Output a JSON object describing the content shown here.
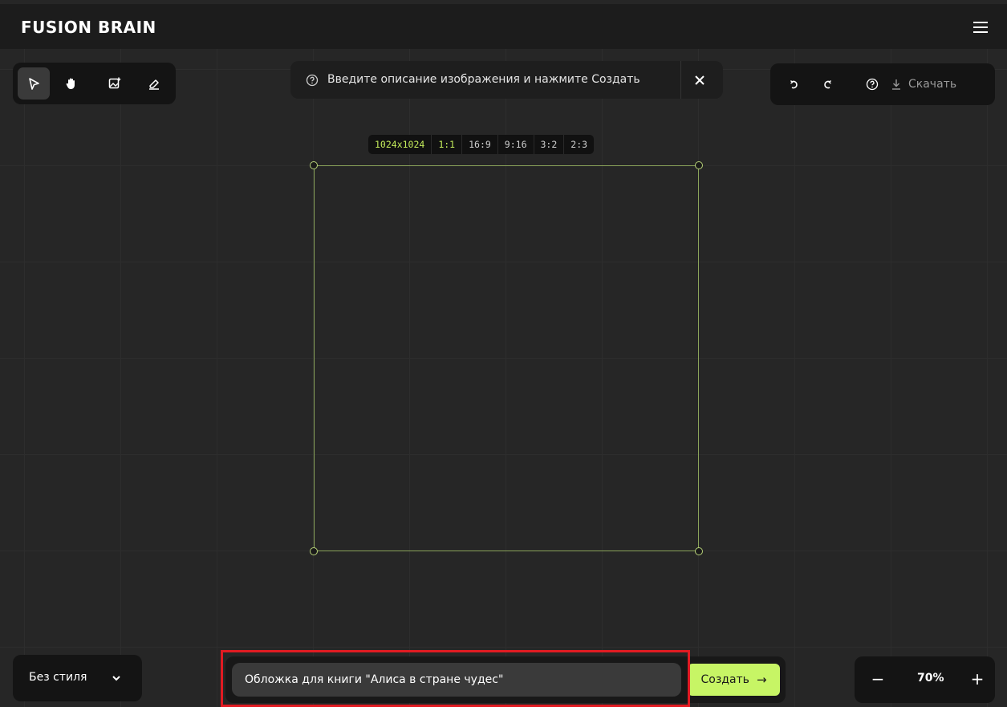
{
  "app": {
    "logo": "FUSION BRAIN"
  },
  "toolbar": {
    "tools": [
      {
        "name": "select",
        "icon": "cursor-icon",
        "active": true
      },
      {
        "name": "hand",
        "icon": "hand-icon",
        "active": false
      },
      {
        "name": "image",
        "icon": "image-add-icon",
        "active": false
      },
      {
        "name": "eraser",
        "icon": "eraser-icon",
        "active": false
      }
    ]
  },
  "hint": {
    "text": "Введите описание изображения и нажмите Создать",
    "icon": "help-circle-icon",
    "close_icon": "close-icon"
  },
  "history": {
    "undo_icon": "undo-icon",
    "redo_icon": "redo-icon",
    "help_icon": "help-circle-icon",
    "download_icon": "download-icon",
    "download_label": "Скачать"
  },
  "ratios": {
    "resolution": "1024x1024",
    "options": [
      "1:1",
      "16:9",
      "9:16",
      "3:2",
      "2:3"
    ],
    "selected": "1:1"
  },
  "style_select": {
    "value": "Без стиля",
    "icon": "chevron-down-icon"
  },
  "prompt": {
    "value": "Обложка для книги \"Алиса в стране чудес\"",
    "create_label": "Создать",
    "create_icon": "arrow-right-icon"
  },
  "zoom": {
    "value": "70%",
    "minus": "−",
    "plus": "+"
  },
  "colors": {
    "accent": "#c7f565",
    "frame": "#8aa35a",
    "highlight": "#e11b22",
    "panel": "#141414"
  }
}
